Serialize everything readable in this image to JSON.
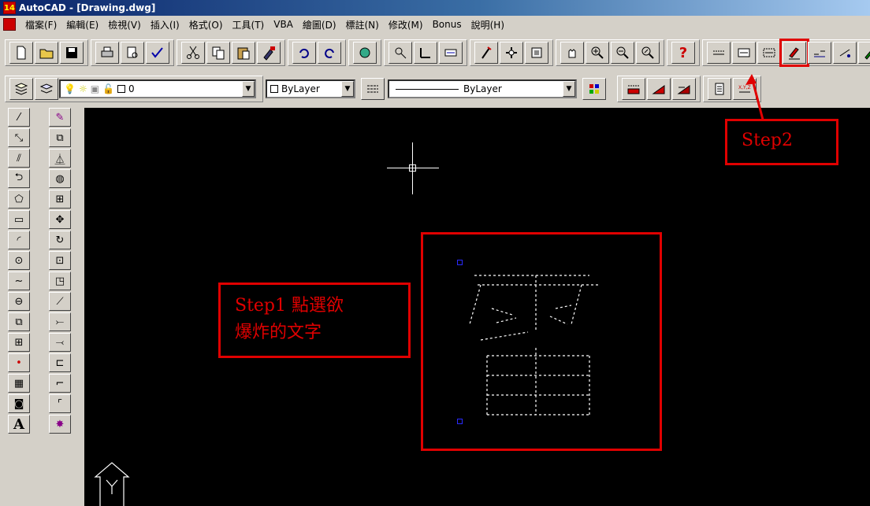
{
  "window": {
    "title": "AutoCAD - [Drawing.dwg]",
    "app_icon_text": "14"
  },
  "menu": {
    "items": [
      "檔案(F)",
      "編輯(E)",
      "檢視(V)",
      "插入(I)",
      "格式(O)",
      "工具(T)",
      "VBA",
      "繪圖(D)",
      "標註(N)",
      "修改(M)",
      "Bonus",
      "說明(H)"
    ]
  },
  "toolbar": {
    "help_label": "?",
    "highlighted_tool_icon": "explode-text-icon"
  },
  "properties": {
    "layer_value": "0",
    "color_value": "ByLayer",
    "linetype_value": "ByLayer"
  },
  "palette": {
    "text_tool_label": "A"
  },
  "annotations": {
    "step1_line1": "Step1 點選欲",
    "step1_line2": "爆炸的文字",
    "step2": "Step2"
  },
  "colors": {
    "annotation_red": "#e00000",
    "canvas_bg": "#000000",
    "title_bar": "#0a246a",
    "grip_blue": "#2a2aff"
  }
}
